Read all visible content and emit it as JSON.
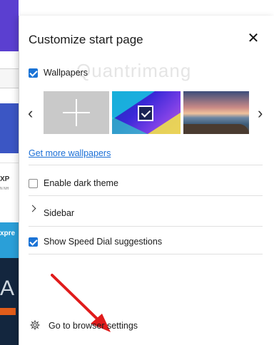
{
  "panel": {
    "title": "Customize start page",
    "close_glyph": "✕",
    "wallpapers": {
      "label": "Wallpapers",
      "checked": true
    },
    "wallpaper_thumbnails": [
      {
        "name": "add-wallpaper",
        "icon": "plus-icon"
      },
      {
        "name": "abstract-blue",
        "selected": true
      },
      {
        "name": "beach-sunset"
      }
    ],
    "prev_glyph": "‹",
    "next_glyph": "›",
    "get_more_link": "Get more wallpapers",
    "dark_theme": {
      "label": "Enable dark theme",
      "checked": false
    },
    "sidebar": {
      "label": "Sidebar"
    },
    "speed_dial": {
      "label": "Show Speed Dial suggestions",
      "checked": true
    },
    "browser_settings": {
      "label": "Go to browser settings",
      "icon": "gear-icon"
    }
  },
  "background_page": {
    "fragment_1": "XP",
    "fragment_2": "N NH",
    "fragment_3": "xpre",
    "fragment_4": "A"
  },
  "watermark": "Quantrimang",
  "colors": {
    "accent": "#1a73d6",
    "link": "#1a6fd6",
    "annotation_arrow": "#e01b1b"
  }
}
